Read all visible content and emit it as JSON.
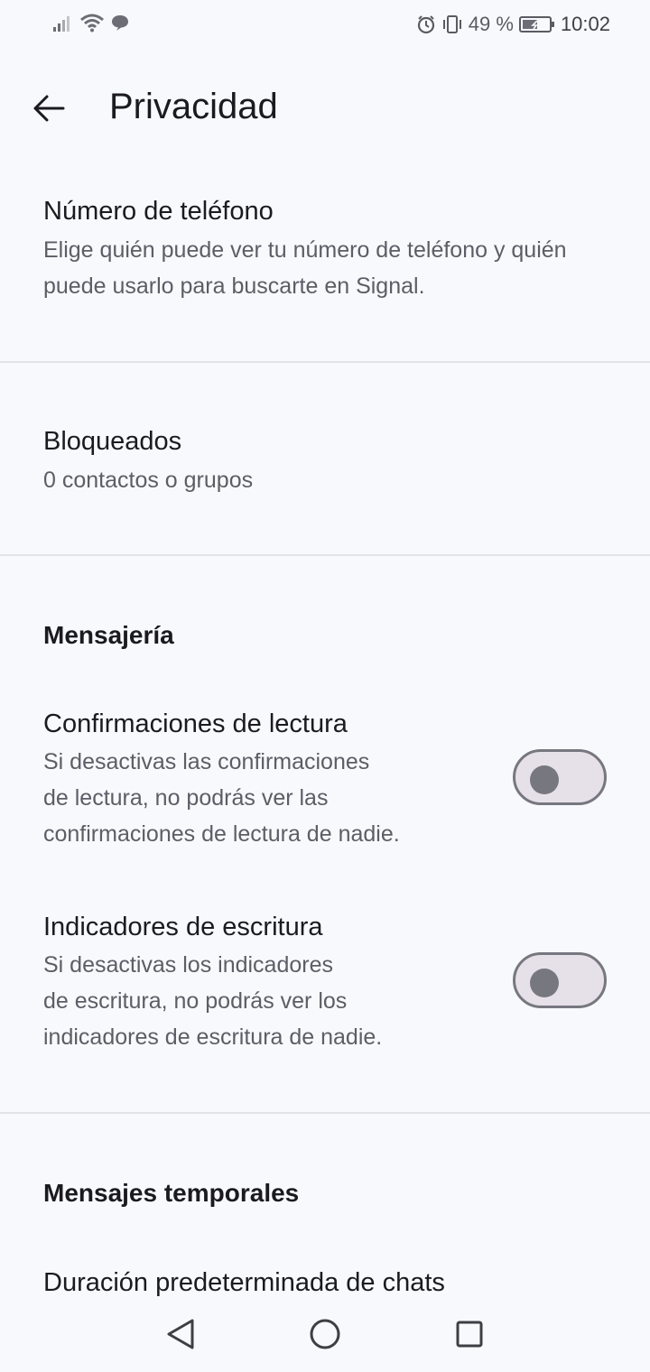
{
  "status_bar": {
    "battery_percent": "49 %",
    "time": "10:02"
  },
  "app_bar": {
    "title": "Privacidad"
  },
  "items": {
    "phone": {
      "title": "Número de teléfono",
      "subtitle": "Elige quién puede ver tu número de teléfono y quién puede usarlo para buscarte en Signal."
    },
    "blocked": {
      "title": "Bloqueados",
      "subtitle": "0 contactos o grupos"
    }
  },
  "messaging": {
    "header": "Mensajería",
    "read_receipts": {
      "title": "Confirmaciones de lectura",
      "subtitle_lines": [
        "Si desactivas las confirmaciones",
        "de lectura, no podrás ver las",
        "confirmaciones de lectura de nadie."
      ],
      "enabled": false
    },
    "typing_indicators": {
      "title": "Indicadores de escritura",
      "subtitle_lines": [
        "Si desactivas los indicadores",
        "de escritura, no podrás ver los",
        "indicadores de escritura de nadie."
      ],
      "enabled": false
    }
  },
  "disappearing": {
    "header": "Mensajes temporales",
    "default_timer": {
      "title": "Duración predeterminada de chats"
    }
  },
  "icons": {
    "back": "arrow-left-icon",
    "nav_back": "triangle-back-icon",
    "nav_home": "circle-home-icon",
    "nav_recents": "square-recents-icon"
  },
  "colors": {
    "background": "#f8f9fd",
    "divider": "#e2e3e9",
    "toggle_track": "#e6e0e9",
    "toggle_outline": "#77777f"
  }
}
